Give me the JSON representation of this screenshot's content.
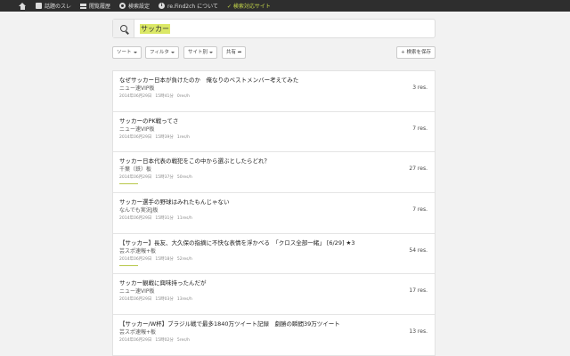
{
  "nav": {
    "items": [
      {
        "label": "話題のスレ",
        "icon": "fire-icon"
      },
      {
        "label": "閲覧履歴",
        "icon": "list-icon"
      },
      {
        "label": "検索設定",
        "icon": "gear-icon"
      },
      {
        "label": "re.Find2ch について",
        "icon": "info-icon"
      },
      {
        "label": "✓ 検索対応サイト",
        "icon": "check-icon"
      }
    ]
  },
  "search": {
    "value": "サッカー"
  },
  "filters": {
    "sort": "ソート",
    "filter": "フィルタ",
    "site": "サイト別",
    "share": "共有 ➦",
    "save": "+ 検索を保存"
  },
  "results": [
    {
      "title": "なぜサッカー日本が負けたのか　俺なりのベストメンバー考えてみた",
      "board": "ニュー速VIP板",
      "date": "2014年06月29日",
      "time": "15時41分",
      "speed": "0res/h",
      "res": "3 res.",
      "activity": 0
    },
    {
      "title": "サッカーのPK戦ってさ",
      "board": "ニュー速VIP板",
      "date": "2014年06月29日",
      "time": "15時39分",
      "speed": "1res/h",
      "res": "7 res.",
      "activity": 0
    },
    {
      "title": "サッカー日本代表の戦犯をこの中から選ぶとしたらどれ？",
      "board": "千葉（鉄）板",
      "date": "2014年06月29日",
      "time": "15時37分",
      "speed": "50res/h",
      "res": "27 res.",
      "activity": 0.06
    },
    {
      "title": "サッカー選手の野球はみれたもんじゃない",
      "board": "なんでも実況J板",
      "date": "2014年06月29日",
      "time": "15時31分",
      "speed": "11res/h",
      "res": "7 res.",
      "activity": 0
    },
    {
      "title": "【サッカー】長友、大久保の指摘に不快な表情を浮かべる　「クロス全部一緒」 [6/29] ★3",
      "board": "芸スポ速報+板",
      "date": "2014年06月29日",
      "time": "15時18分",
      "speed": "52res/h",
      "res": "54 res.",
      "activity": 0.06
    },
    {
      "title": "サッカー観戦に興味持ったんだが",
      "board": "ニュー速VIP板",
      "date": "2014年06月29日",
      "time": "15時03分",
      "speed": "13res/h",
      "res": "17 res.",
      "activity": 0
    },
    {
      "title": "【サッカー/W杯】ブラジル戦で最多1840万ツイート記録　劇勝の瞬間39万ツイート",
      "board": "芸スポ速報+板",
      "date": "2014年06月29日",
      "time": "15時02分",
      "speed": "5res/h",
      "res": "13 res.",
      "activity": 0
    }
  ]
}
